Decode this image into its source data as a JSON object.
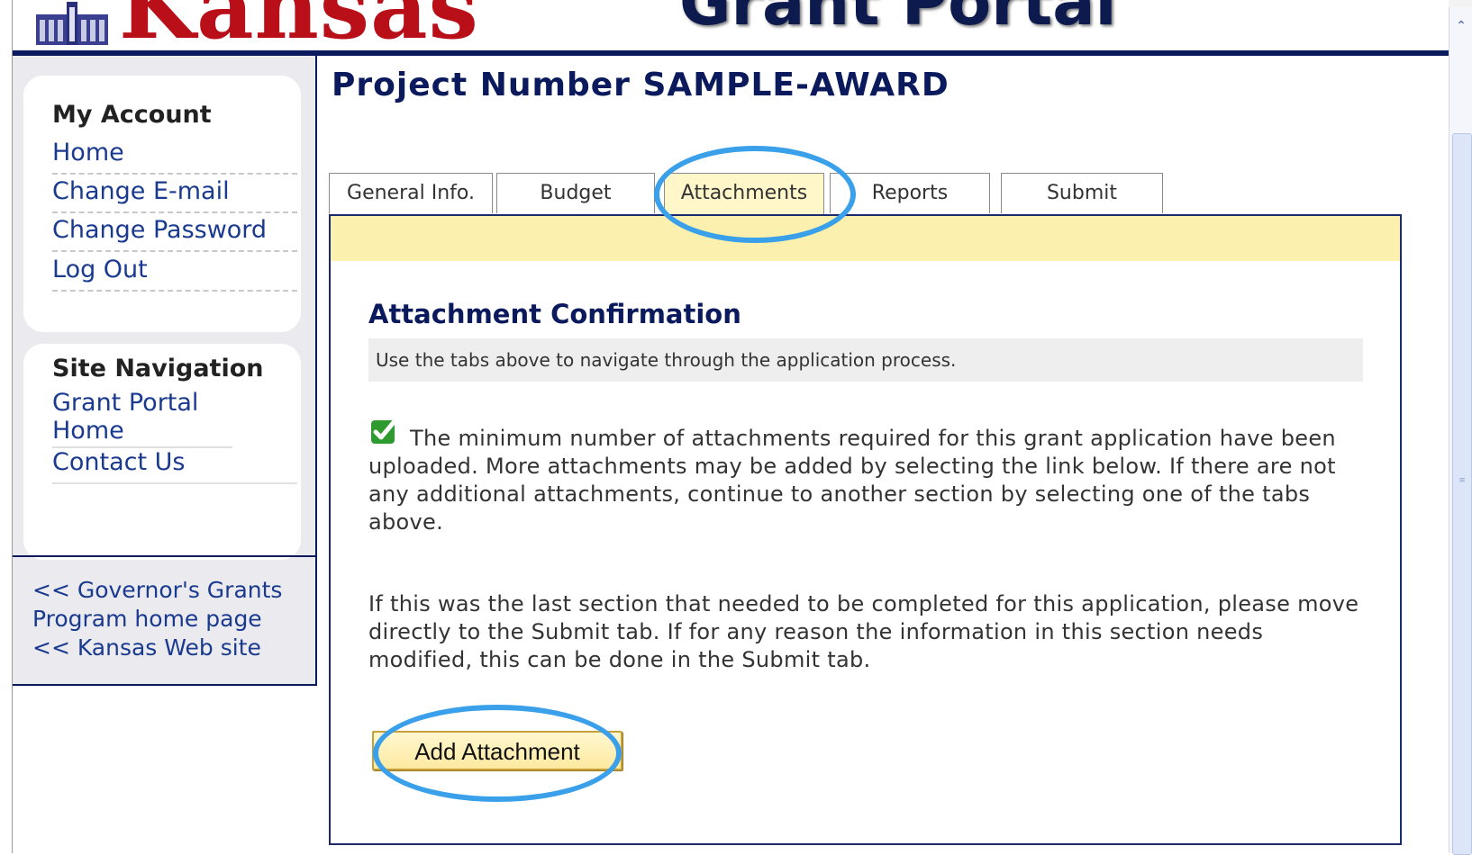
{
  "header": {
    "site_title": "Kansas",
    "portal_title": "Grant Portal"
  },
  "sidebar": {
    "account_heading": "My Account",
    "account_links": [
      "Home",
      "Change E-mail",
      "Change Password",
      "Log Out"
    ],
    "nav_heading": "Site Navigation",
    "nav_links": [
      "Grant Portal Home",
      "Contact Us"
    ],
    "footer_links": [
      "<< Governor's Grants Program home page",
      "<< Kansas Web site"
    ]
  },
  "main": {
    "project_title": "Project Number SAMPLE-AWARD",
    "tabs": [
      {
        "label": "General Info.",
        "active": false
      },
      {
        "label": "Budget",
        "active": false
      },
      {
        "label": "Attachments",
        "active": true
      },
      {
        "label": "Reports",
        "active": false
      },
      {
        "label": "Submit",
        "active": false
      }
    ],
    "section_heading": "Attachment Confirmation",
    "instructions": "Use the tabs above to navigate through the application process.",
    "confirmation_text": "The minimum number of attachments required for this grant application have been uploaded. More attachments may be added by selecting the link below. If there are not any additional attachments, continue to another section by selecting one of the tabs above.",
    "submit_note": "If this was the last section that needed to be completed for this application, please move directly to the Submit tab. If for any reason the information in this section needs modified, this can be done in the Submit tab.",
    "add_button_label": "Add Attachment"
  },
  "icons": {
    "capitol": "capitol-building-icon",
    "check": "green-check-icon",
    "scroll_up": "scroll-up-arrow-icon"
  },
  "colors": {
    "brand_red": "#b80f18",
    "navy": "#0b1a5c",
    "link_blue": "#1a3a8f",
    "highlight_strip": "#fbf0ae",
    "annotation_oval": "#3aa0ea",
    "check_green": "#2f9a2f"
  }
}
